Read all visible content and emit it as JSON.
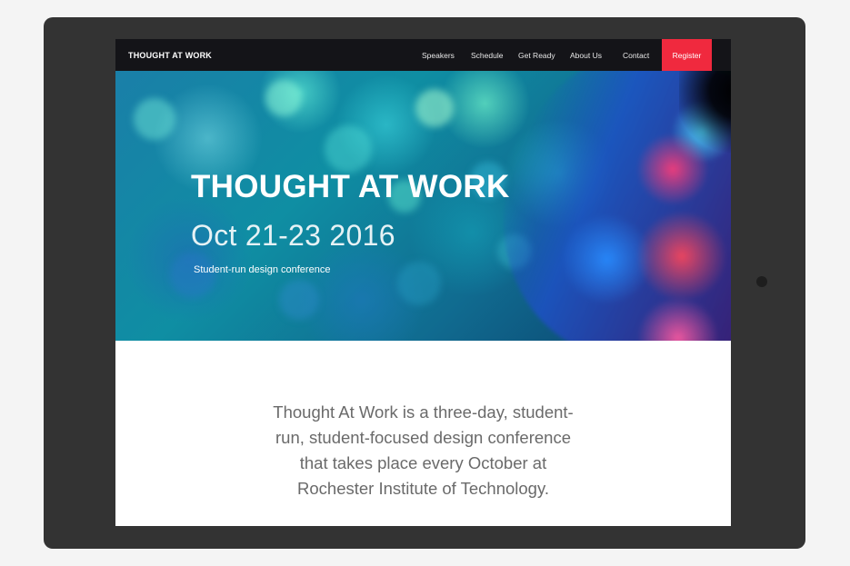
{
  "brand": {
    "name": "THOUGHT AT WORK"
  },
  "nav": {
    "items": [
      {
        "label": "Speakers"
      },
      {
        "label": "Schedule"
      },
      {
        "label": "Get Ready"
      },
      {
        "label": "About Us"
      },
      {
        "label": "Contact"
      }
    ],
    "register_label": "Register"
  },
  "hero": {
    "title": "THOUGHT AT WORK",
    "date": "Oct 21-23 2016",
    "subtitle": "Student-run design conference"
  },
  "about": {
    "text": "Thought At Work is a three-day, student-run, student-focused design conference that takes place every October at Rochester Institute of Technology."
  },
  "colors": {
    "register_bg": "#f0293e",
    "navbar_bg": "#141418",
    "device_frame": "#333333"
  }
}
